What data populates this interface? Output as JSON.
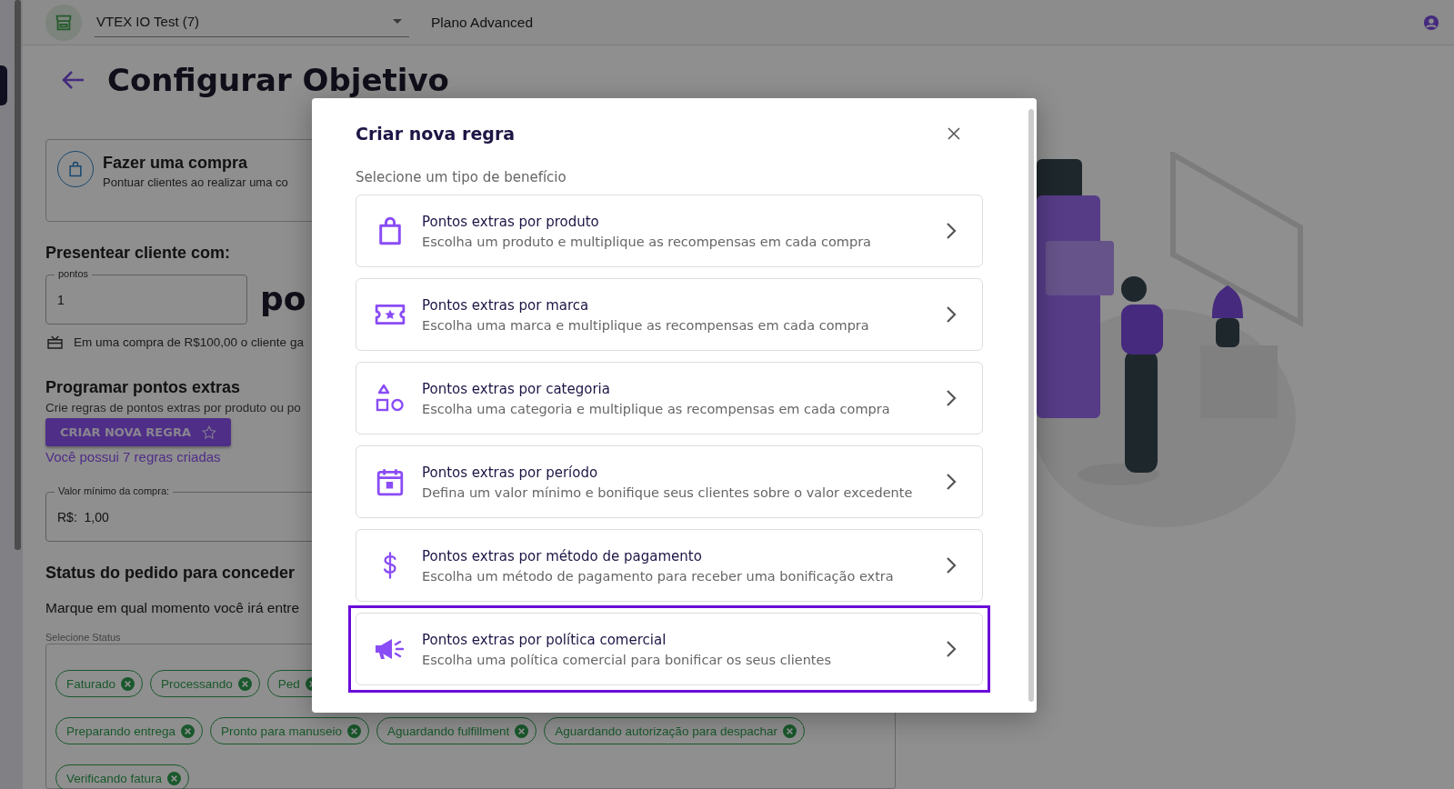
{
  "top_bar": {
    "store_select": "VTEX IO Test (7)",
    "plan": "Plano Advanced"
  },
  "page": {
    "title": "Configurar Objetivo",
    "objective_card": {
      "title": "Fazer uma compra",
      "description": "Pontuar clientes ao realizar uma co"
    },
    "reward": {
      "heading": "Presentear cliente com:",
      "points_field": {
        "label": "pontos",
        "value": "1"
      },
      "unit_text": "po",
      "hint": "Em uma compra de R$100,00 o cliente ga"
    },
    "extra_points": {
      "heading": "Programar pontos extras",
      "description": "Crie regras de pontos extras por produto ou po",
      "button": "CRIAR NOVA REGRA",
      "rules_link": "Você possui 7 regras criadas"
    },
    "min_value_field": {
      "label": "Valor mínimo da compra:",
      "prefix": "R$:",
      "value": "1,00"
    },
    "status": {
      "heading": "Status do pedido para conceder",
      "description": "Marque em qual momento você irá entre",
      "select_label": "Selecione Status",
      "chip_rows": [
        [
          "Faturado",
          "Processando",
          "Ped"
        ],
        [
          "Preparando entrega",
          "Pronto para manuseio",
          "Aguardando fulfillment",
          "Aguardando autorização para despachar"
        ],
        [
          "Verificando fatura"
        ]
      ]
    }
  },
  "modal": {
    "title": "Criar nova regra",
    "subtitle": "Selecione um tipo de benefício",
    "options": [
      {
        "kind": "bag",
        "title": "Pontos extras por produto",
        "description": "Escolha um produto e multiplique as recompensas em cada compra",
        "selected": false
      },
      {
        "kind": "ticket",
        "title": "Pontos extras por marca",
        "description": "Escolha uma marca e multiplique as recompensas em cada compra",
        "selected": false
      },
      {
        "kind": "shapes",
        "title": "Pontos extras por categoria",
        "description": "Escolha uma categoria e multiplique as recompensas em cada compra",
        "selected": false
      },
      {
        "kind": "calendar",
        "title": "Pontos extras por período",
        "description": "Defina um valor mínimo e bonifique seus clientes sobre o valor excedente",
        "selected": false
      },
      {
        "kind": "dollar",
        "title": "Pontos extras por método de pagamento",
        "description": "Escolha um método de pagamento para receber uma bonificação extra",
        "selected": false
      },
      {
        "kind": "megaphone",
        "title": "Pontos extras por política comercial",
        "description": "Escolha uma política comercial para bonificar os seus clientes",
        "selected": true
      }
    ]
  }
}
